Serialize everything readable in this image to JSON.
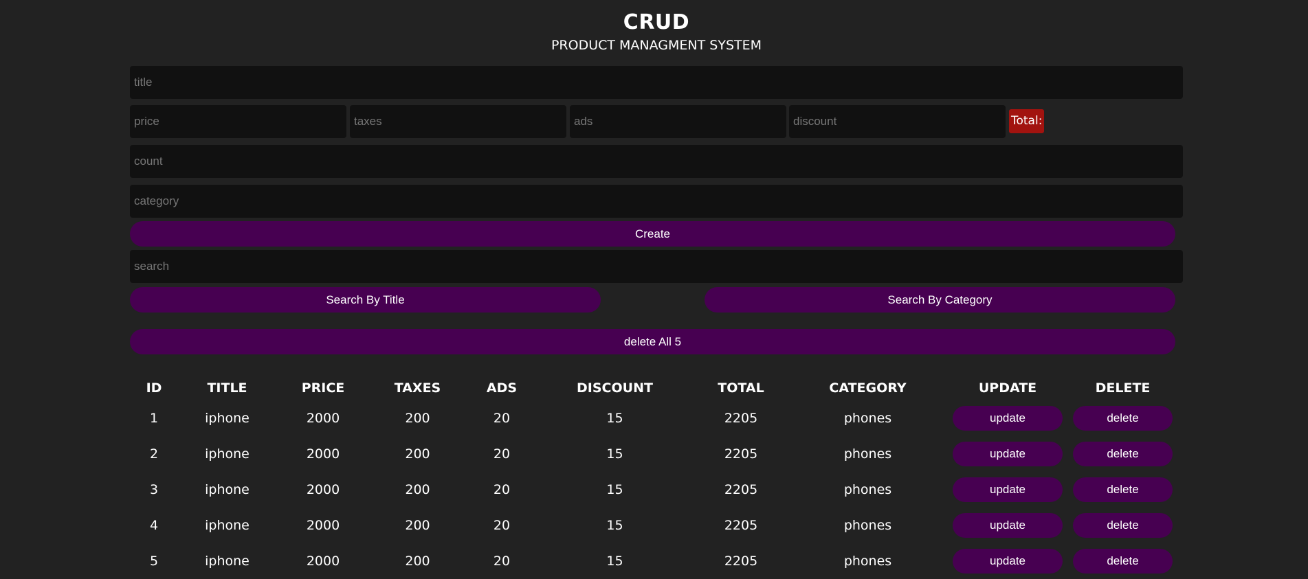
{
  "header": {
    "title": "CRUD",
    "subtitle": "PRODUCT MANAGMENT SYSTEM"
  },
  "form": {
    "title_placeholder": "title",
    "price_placeholder": "price",
    "taxes_placeholder": "taxes",
    "ads_placeholder": "ads",
    "discount_placeholder": "discount",
    "total_label": "Total:",
    "count_placeholder": "count",
    "category_placeholder": "category",
    "create_label": "Create"
  },
  "search": {
    "placeholder": "search",
    "by_title_label": "Search By Title",
    "by_category_label": "Search By Category"
  },
  "delete_all_label": "delete All 5",
  "table": {
    "columns": [
      "ID",
      "TITLE",
      "PRICE",
      "TAXES",
      "ADS",
      "DISCOUNT",
      "TOTAL",
      "CATEGORY",
      "UPDATE",
      "DELETE"
    ],
    "update_label": "update",
    "delete_label": "delete",
    "rows": [
      {
        "id": "1",
        "title": "iphone",
        "price": "2000",
        "taxes": "200",
        "ads": "20",
        "discount": "15",
        "total": "2205",
        "category": "phones"
      },
      {
        "id": "2",
        "title": "iphone",
        "price": "2000",
        "taxes": "200",
        "ads": "20",
        "discount": "15",
        "total": "2205",
        "category": "phones"
      },
      {
        "id": "3",
        "title": "iphone",
        "price": "2000",
        "taxes": "200",
        "ads": "20",
        "discount": "15",
        "total": "2205",
        "category": "phones"
      },
      {
        "id": "4",
        "title": "iphone",
        "price": "2000",
        "taxes": "200",
        "ads": "20",
        "discount": "15",
        "total": "2205",
        "category": "phones"
      },
      {
        "id": "5",
        "title": "iphone",
        "price": "2000",
        "taxes": "200",
        "ads": "20",
        "discount": "15",
        "total": "2205",
        "category": "phones"
      }
    ]
  },
  "colors": {
    "background": "#222222",
    "input_background": "#111111",
    "button": "#470051",
    "total_badge": "#a2130f"
  }
}
